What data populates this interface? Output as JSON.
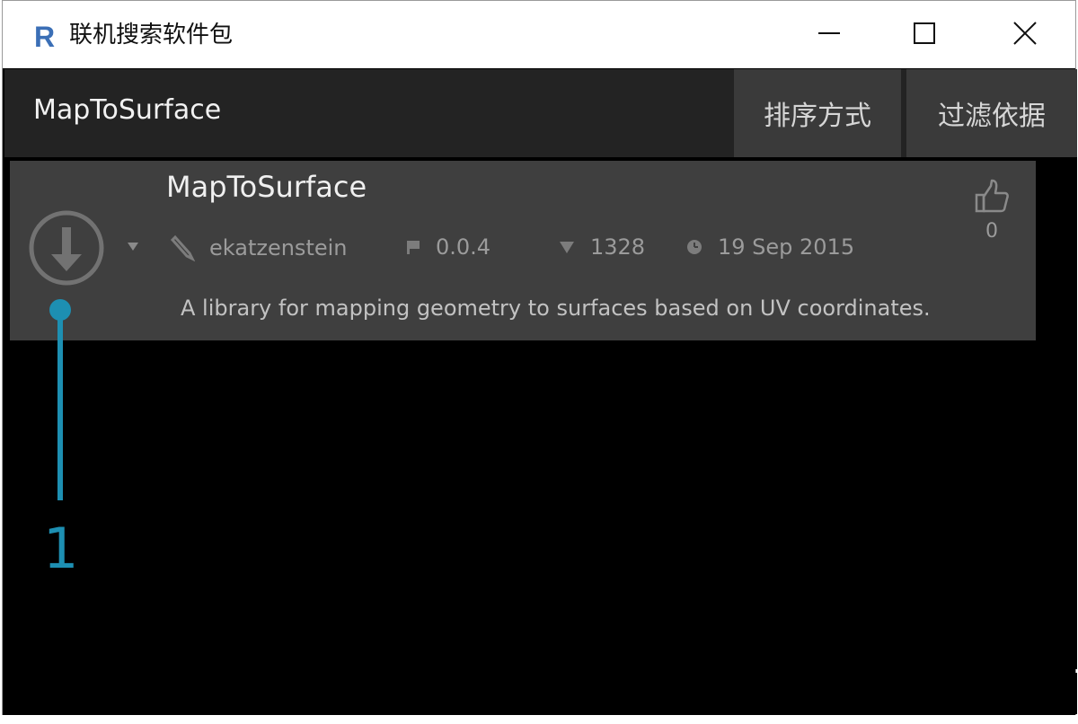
{
  "window": {
    "title": "联机搜索软件包",
    "logo_letter": "R",
    "controls": [
      "minimize-icon",
      "maximize-icon",
      "close-icon"
    ]
  },
  "toolbar": {
    "search_value": "MapToSurface",
    "sort_label": "排序方式",
    "filter_label": "过滤依据"
  },
  "results": [
    {
      "name": "MapToSurface",
      "author": "ekatzenstein",
      "version": "0.0.4",
      "downloads": "1328",
      "date": "19 Sep 2015",
      "votes": "0",
      "description": "A library for mapping geometry to surfaces based on UV coordinates."
    }
  ],
  "callout": {
    "number": "1"
  },
  "colors": {
    "accent": "#1d8fb2",
    "toolbar_bg": "#232323",
    "card_bg": "#3f3f3f",
    "button_bg": "#3a3a3a",
    "logo_blue": "#3b6fb6"
  }
}
